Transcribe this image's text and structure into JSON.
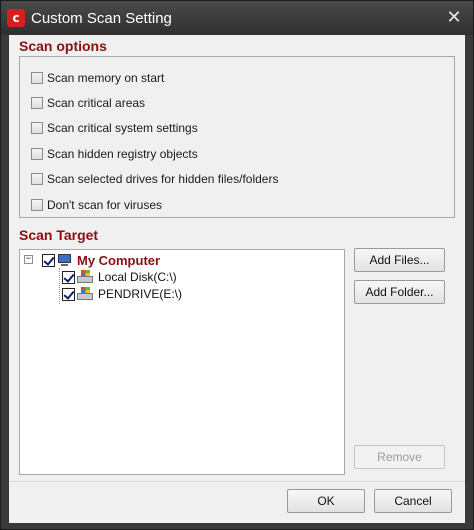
{
  "window": {
    "title": "Custom Scan Setting",
    "logo_text": "c",
    "close_glyph": "✕"
  },
  "scan_options": {
    "heading": "Scan options",
    "items": [
      {
        "label": "Scan memory on start",
        "checked": false
      },
      {
        "label": "Scan critical areas",
        "checked": false
      },
      {
        "label": "Scan critical system settings",
        "checked": false
      },
      {
        "label": "Scan hidden registry objects",
        "checked": false
      },
      {
        "label": "Scan selected drives for hidden files/folders",
        "checked": false
      },
      {
        "label": "Don't scan for viruses",
        "checked": false
      }
    ]
  },
  "scan_target": {
    "heading": "Scan Target",
    "tree": {
      "expander": "−",
      "root": {
        "label": "My Computer",
        "checked": true,
        "icon": "computer-icon"
      },
      "children": [
        {
          "label": "Local Disk(C:\\)",
          "checked": true,
          "icon": "drive-icon"
        },
        {
          "label": "PENDRIVE(E:\\)",
          "checked": true,
          "icon": "drive-icon"
        }
      ]
    },
    "buttons": {
      "add_files": "Add Files...",
      "add_folder": "Add Folder...",
      "remove": "Remove"
    }
  },
  "footer": {
    "ok": "OK",
    "cancel": "Cancel"
  },
  "colors": {
    "title_bar": "#3a3a3a",
    "heading": "#8b0f12",
    "dialog_bg": "#f0f0f0"
  }
}
